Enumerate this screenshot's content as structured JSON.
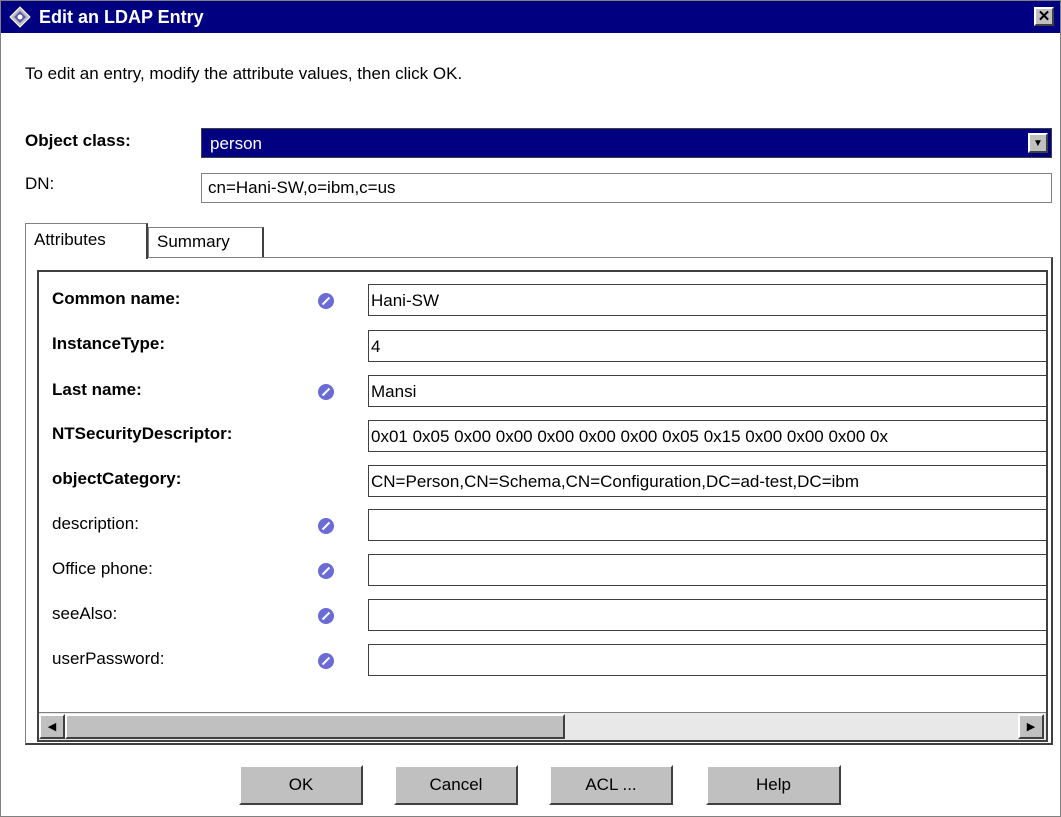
{
  "window": {
    "title": "Edit an LDAP Entry",
    "close_label": "✕"
  },
  "instructions": "To edit an entry, modify the attribute values, then click OK.",
  "object_class": {
    "label": "Object class:",
    "value": "person"
  },
  "dn": {
    "label": "DN:",
    "value": "cn=Hani-SW,o=ibm,c=us"
  },
  "tabs": [
    {
      "label": "Attributes",
      "active": true
    },
    {
      "label": "Summary",
      "active": false
    }
  ],
  "attributes": [
    {
      "label": "Common name:",
      "required": true,
      "editable_icon": true,
      "value": "Hani-SW"
    },
    {
      "label": "InstanceType:",
      "required": true,
      "editable_icon": false,
      "value": "4"
    },
    {
      "label": "Last name:",
      "required": true,
      "editable_icon": true,
      "value": "Mansi"
    },
    {
      "label": "NTSecurityDescriptor:",
      "required": true,
      "editable_icon": false,
      "value": "0x01 0x05 0x00 0x00 0x00 0x00 0x00 0x05 0x15 0x00 0x00 0x00 0x"
    },
    {
      "label": "objectCategory:",
      "required": true,
      "editable_icon": false,
      "value": "CN=Person,CN=Schema,CN=Configuration,DC=ad-test,DC=ibm"
    },
    {
      "label": "description:",
      "required": false,
      "editable_icon": true,
      "value": ""
    },
    {
      "label": "Office phone:",
      "required": false,
      "editable_icon": true,
      "value": ""
    },
    {
      "label": "seeAlso:",
      "required": false,
      "editable_icon": true,
      "value": ""
    },
    {
      "label": "userPassword:",
      "required": false,
      "editable_icon": true,
      "value": ""
    }
  ],
  "buttons": {
    "ok": "OK",
    "cancel": "Cancel",
    "acl": "ACL ...",
    "help": "Help"
  },
  "icons": {
    "app": "ldap-entry-icon",
    "edit": "pencil-icon"
  },
  "colors": {
    "title_bar": "#000080",
    "selection": "#000080",
    "edit_icon": "#6b6bd6"
  }
}
